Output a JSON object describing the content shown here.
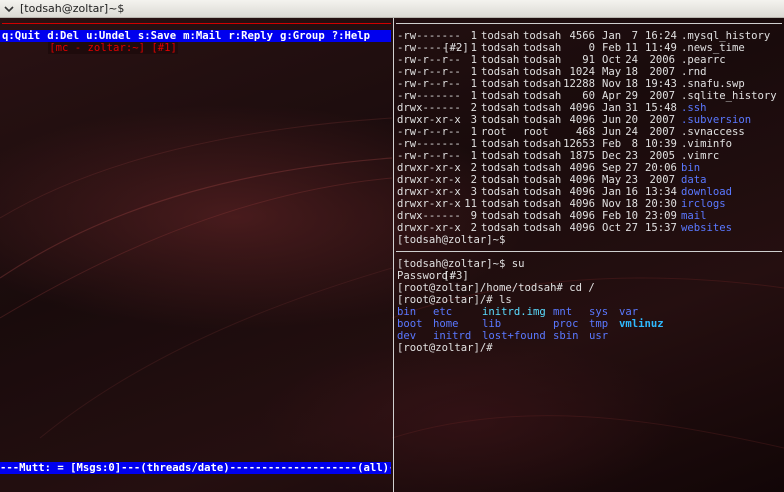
{
  "window": {
    "title": "[todsah@zoltar]~$"
  },
  "pane1": {
    "title": "[mc - zoltar:~] [#1]",
    "help_items": [
      "q:Quit",
      "d:Del",
      "u:Undel",
      "s:Save",
      "m:Mail",
      "r:Reply",
      "g:Group",
      "?:Help"
    ],
    "status": "---Mutt: = [Msgs:0]---(threads/date)--------------------(all)---"
  },
  "pane2": {
    "title": "[#2]",
    "listing": [
      {
        "perm": "-rw-------",
        "links": "1",
        "owner": "todsah",
        "group": "todsah",
        "size": "4566",
        "month": "Jan",
        "day": "7",
        "time": "16:24",
        "name": ".mysql_history",
        "is_dir": false
      },
      {
        "perm": "-rw-------",
        "links": "1",
        "owner": "todsah",
        "group": "todsah",
        "size": "0",
        "month": "Feb",
        "day": "11",
        "time": "11:49",
        "name": ".news_time",
        "is_dir": false
      },
      {
        "perm": "-rw-r--r--",
        "links": "1",
        "owner": "todsah",
        "group": "todsah",
        "size": "91",
        "month": "Oct",
        "day": "24",
        "time": "2006",
        "name": ".pearrc",
        "is_dir": false
      },
      {
        "perm": "-rw-r--r--",
        "links": "1",
        "owner": "todsah",
        "group": "todsah",
        "size": "1024",
        "month": "May",
        "day": "18",
        "time": "2007",
        "name": ".rnd",
        "is_dir": false
      },
      {
        "perm": "-rw-r--r--",
        "links": "1",
        "owner": "todsah",
        "group": "todsah",
        "size": "12288",
        "month": "Nov",
        "day": "18",
        "time": "19:43",
        "name": ".snafu.swp",
        "is_dir": false
      },
      {
        "perm": "-rw-------",
        "links": "1",
        "owner": "todsah",
        "group": "todsah",
        "size": "60",
        "month": "Apr",
        "day": "29",
        "time": "2007",
        "name": ".sqlite_history",
        "is_dir": false
      },
      {
        "perm": "drwx------",
        "links": "2",
        "owner": "todsah",
        "group": "todsah",
        "size": "4096",
        "month": "Jan",
        "day": "31",
        "time": "15:48",
        "name": ".ssh",
        "is_dir": true
      },
      {
        "perm": "drwxr-xr-x",
        "links": "3",
        "owner": "todsah",
        "group": "todsah",
        "size": "4096",
        "month": "Jun",
        "day": "20",
        "time": "2007",
        "name": ".subversion",
        "is_dir": true
      },
      {
        "perm": "-rw-r--r--",
        "links": "1",
        "owner": "root",
        "group": "root",
        "size": "468",
        "month": "Jun",
        "day": "24",
        "time": "2007",
        "name": ".svnaccess",
        "is_dir": false
      },
      {
        "perm": "-rw-------",
        "links": "1",
        "owner": "todsah",
        "group": "todsah",
        "size": "12653",
        "month": "Feb",
        "day": "8",
        "time": "10:39",
        "name": ".viminfo",
        "is_dir": false
      },
      {
        "perm": "-rw-r--r--",
        "links": "1",
        "owner": "todsah",
        "group": "todsah",
        "size": "1875",
        "month": "Dec",
        "day": "23",
        "time": "2005",
        "name": ".vimrc",
        "is_dir": false
      },
      {
        "perm": "drwxr-xr-x",
        "links": "2",
        "owner": "todsah",
        "group": "todsah",
        "size": "4096",
        "month": "Sep",
        "day": "27",
        "time": "20:06",
        "name": "bin",
        "is_dir": true
      },
      {
        "perm": "drwxr-xr-x",
        "links": "2",
        "owner": "todsah",
        "group": "todsah",
        "size": "4096",
        "month": "May",
        "day": "23",
        "time": "2007",
        "name": "data",
        "is_dir": true
      },
      {
        "perm": "drwxr-xr-x",
        "links": "3",
        "owner": "todsah",
        "group": "todsah",
        "size": "4096",
        "month": "Jan",
        "day": "16",
        "time": "13:34",
        "name": "download",
        "is_dir": true
      },
      {
        "perm": "drwxr-xr-x",
        "links": "11",
        "owner": "todsah",
        "group": "todsah",
        "size": "4096",
        "month": "Nov",
        "day": "18",
        "time": "20:30",
        "name": "irclogs",
        "is_dir": true
      },
      {
        "perm": "drwx------",
        "links": "9",
        "owner": "todsah",
        "group": "todsah",
        "size": "4096",
        "month": "Feb",
        "day": "10",
        "time": "23:09",
        "name": "mail",
        "is_dir": true
      },
      {
        "perm": "drwxr-xr-x",
        "links": "2",
        "owner": "todsah",
        "group": "todsah",
        "size": "4096",
        "month": "Oct",
        "day": "27",
        "time": "15:37",
        "name": "websites",
        "is_dir": true
      }
    ],
    "prompt": "[todsah@zoltar]~$"
  },
  "pane3": {
    "title": "[#3]",
    "lines": [
      "[todsah@zoltar]~$ su",
      "Password:",
      "[root@zoltar]/home/todsah# cd /",
      "[root@zoltar]/# ls"
    ],
    "ls_output": [
      [
        {
          "name": "bin",
          "kind": "dir"
        },
        {
          "name": "etc",
          "kind": "dir"
        },
        {
          "name": "initrd.img",
          "kind": "link"
        },
        {
          "name": "mnt",
          "kind": "dir"
        },
        {
          "name": "sys",
          "kind": "dir"
        },
        {
          "name": "var",
          "kind": "dir"
        }
      ],
      [
        {
          "name": "boot",
          "kind": "dir"
        },
        {
          "name": "home",
          "kind": "dir"
        },
        {
          "name": "lib",
          "kind": "dir"
        },
        {
          "name": "proc",
          "kind": "dir"
        },
        {
          "name": "tmp",
          "kind": "dir"
        },
        {
          "name": "vmlinuz",
          "kind": "exec"
        }
      ],
      [
        {
          "name": "dev",
          "kind": "dir"
        },
        {
          "name": "initrd",
          "kind": "dir"
        },
        {
          "name": "lost+found",
          "kind": "dir"
        },
        {
          "name": "sbin",
          "kind": "dir"
        },
        {
          "name": "usr",
          "kind": "dir"
        }
      ]
    ],
    "final_prompt": "[root@zoltar]/#"
  },
  "colors": {
    "mutt_bar": "#0000ee",
    "directory": "#5a78ff",
    "symlink": "#5adcff",
    "pane1_border": "#e00000"
  }
}
